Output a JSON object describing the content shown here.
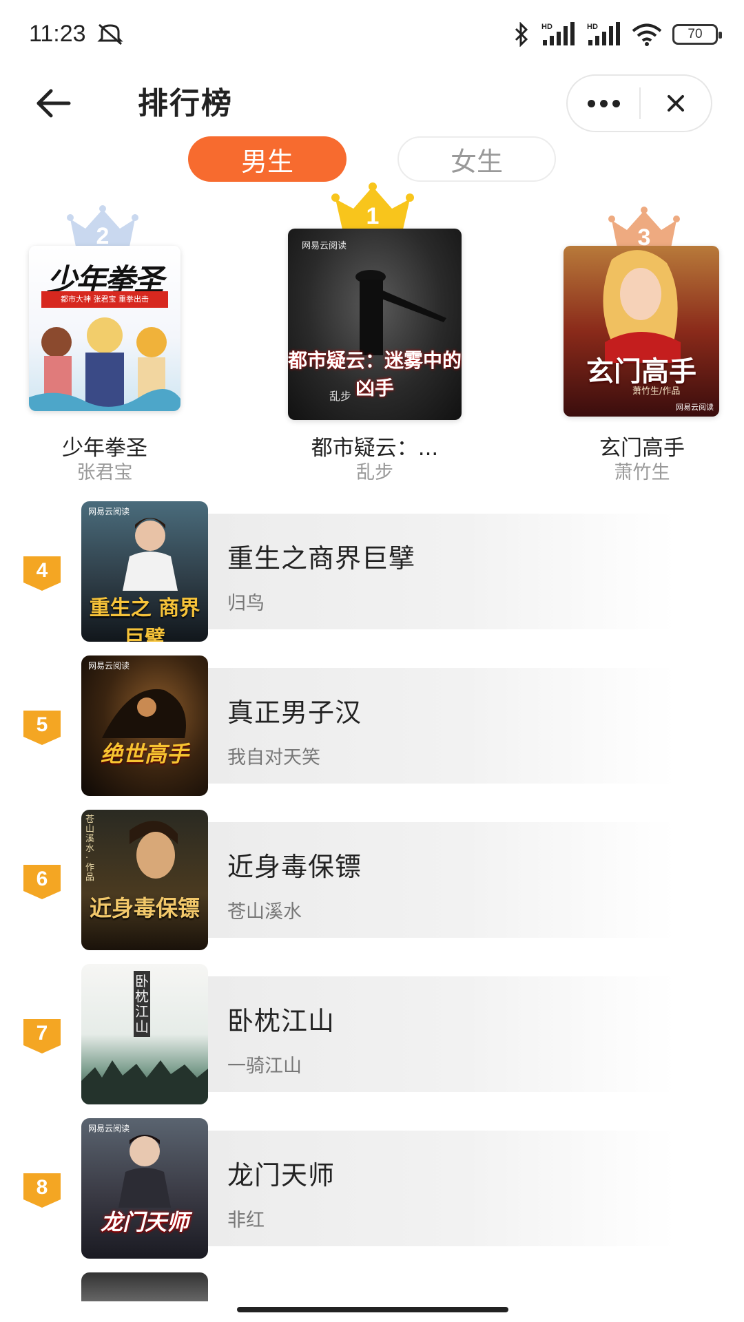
{
  "status_bar": {
    "time": "11:23",
    "battery": "70",
    "network_1": "HD",
    "network_2": "HD"
  },
  "header": {
    "title": "排行榜"
  },
  "tabs": [
    {
      "label": "男生",
      "active": true
    },
    {
      "label": "女生",
      "active": false
    }
  ],
  "top3": [
    {
      "rank": "2",
      "title": "少年拳圣",
      "author": "张君宝",
      "cover_text": "少年拳圣",
      "cover_sub": "都市大神 张君宝 重拳出击"
    },
    {
      "rank": "1",
      "title": "都市疑云：...",
      "author": "乱步",
      "cover_text": "都市疑云：迷雾中的凶手",
      "cover_brand": "网易云阅读",
      "cover_sub": "乱步"
    },
    {
      "rank": "3",
      "title": "玄门高手",
      "author": "萧竹生",
      "cover_text": "玄门高手",
      "cover_sub": "萧竹生/作品",
      "cover_brand": "网易云阅读"
    }
  ],
  "list": [
    {
      "rank": "4",
      "title": "重生之商界巨擘",
      "author": "归鸟",
      "cover_text": "重生之 商界巨擘",
      "cover_brand": "网易云阅读"
    },
    {
      "rank": "5",
      "title": "真正男子汉",
      "author": "我自对天笑",
      "cover_text": "绝世高手",
      "cover_brand": "网易云阅读"
    },
    {
      "rank": "6",
      "title": "近身毒保镖",
      "author": "苍山溪水",
      "cover_text": "近身毒保镖",
      "cover_brand": "苍山溪水·作品"
    },
    {
      "rank": "7",
      "title": "卧枕江山",
      "author": "一骑江山",
      "cover_text": "卧枕江山"
    },
    {
      "rank": "8",
      "title": "龙门天师",
      "author": "非红",
      "cover_text": "龙门天师",
      "cover_brand": "网易云阅读"
    }
  ],
  "colors": {
    "accent": "#f76b2f",
    "rank_badge": "#f4a623",
    "gold": "#f8c51c",
    "silver": "#b9cbe6",
    "bronze": "#e9a47c"
  },
  "icons": [
    "back-arrow-icon",
    "more-dots-icon",
    "close-icon",
    "bluetooth-icon",
    "signal-icon",
    "wifi-icon",
    "battery-icon",
    "mute-icon",
    "crown-icon",
    "rank-badge-icon"
  ]
}
